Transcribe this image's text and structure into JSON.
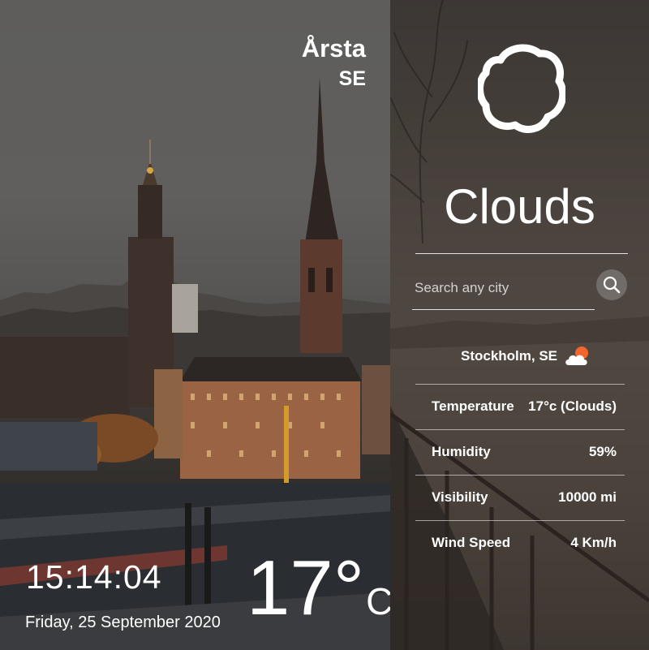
{
  "location": {
    "city": "Årsta",
    "country": "SE"
  },
  "clock": {
    "time": "15:14:04",
    "date": "Friday, 25 September 2020"
  },
  "current": {
    "temp_value": "17°",
    "temp_unit": "C"
  },
  "panel": {
    "condition": "Clouds",
    "condition_icon": "clouds-icon",
    "search_placeholder": "Search any city",
    "search_icon": "search-icon",
    "city_label": "Stockholm, SE",
    "city_icon": "sun-behind-cloud-icon",
    "rows": [
      {
        "label": "Temperature",
        "value": "17°c (Clouds)"
      },
      {
        "label": "Humidity",
        "value": "59%"
      },
      {
        "label": "Visibility",
        "value": "10000 mi"
      },
      {
        "label": "Wind Speed",
        "value": "4 Km/h"
      }
    ]
  },
  "colors": {
    "icon_orange": "#f2662e",
    "text": "#ffffff"
  }
}
